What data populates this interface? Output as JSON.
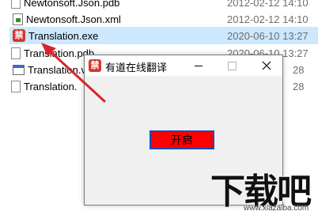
{
  "files": [
    {
      "name": "Newtonsoft.Json.pdb",
      "date": "2012-02-12 14:10",
      "icon": "document-icon",
      "selected": false
    },
    {
      "name": "Newtonsoft.Json.xml",
      "date": "2012-02-12 14:10",
      "icon": "xml-file-icon",
      "selected": false
    },
    {
      "name": "Translation.exe",
      "date": "2020-06-10 13:27",
      "icon": "translation-app-icon",
      "selected": true
    },
    {
      "name": "Translation.pdb",
      "date": "2020-06-10 13:27",
      "icon": "document-icon",
      "selected": false
    },
    {
      "name": "Translation.v",
      "date": "28",
      "icon": "config-file-icon",
      "selected": false
    },
    {
      "name": "Translation.",
      "date": "28",
      "icon": "document-icon",
      "selected": false
    }
  ],
  "app_icon_glyph": "禁",
  "dialog": {
    "title": "有道在线翻译",
    "start_button": "开启",
    "button_color": "#ff0000",
    "button_border_color": "#0a4fc4"
  },
  "annotation": {
    "arrow_color": "#d9262b"
  },
  "watermark": {
    "main": "下载吧",
    "sub": "www.xiazaiba.com"
  }
}
